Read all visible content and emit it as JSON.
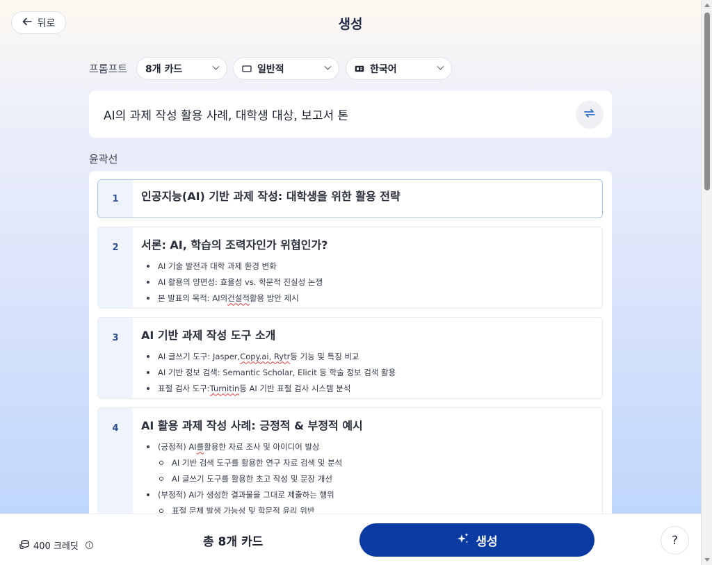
{
  "header": {
    "back_label": "뒤로",
    "title": "생성"
  },
  "prompt": {
    "label": "프롬프트",
    "card_count": "8개 카드",
    "style": "일반적",
    "language": "한국어",
    "text": "AI의 과제 작성 활용 사례, 대학생 대상, 보고서 톤"
  },
  "outline": {
    "label": "윤곽선",
    "cards": [
      {
        "num": "1",
        "title": "인공지능(AI) 기반 과제 작성: 대학생을 위한 활용 전략",
        "bullets": []
      },
      {
        "num": "2",
        "title": "서론: AI, 학습의 조력자인가 위협인가?",
        "bullets": [
          {
            "pre": "AI 기술 발전과 대학 과제 환경 변화",
            "err": "",
            "post": ""
          },
          {
            "pre": "AI 활용의 양면성: 효율성 vs. 학문적 진실성 논쟁",
            "err": "",
            "post": ""
          },
          {
            "pre": "본 발표의 목적: AI의 ",
            "err": "건설적",
            "post": " 활용 방안 제시"
          }
        ]
      },
      {
        "num": "3",
        "title": "AI 기반 과제 작성 도구 소개",
        "bullets": [
          {
            "pre": "AI 글쓰기 도구: Jasper, ",
            "err": "Copy.ai, Rytr",
            "post": " 등 기능 및 특징 비교"
          },
          {
            "pre": "AI 기반 정보 검색: Semantic Scholar, Elicit 등 학술 정보 검색 활용",
            "err": "",
            "post": ""
          },
          {
            "pre": "표절 검사 도구: ",
            "err": "Turnitin",
            "post": " 등 AI 기반 표절 검사 시스템 분석"
          }
        ]
      },
      {
        "num": "4",
        "title": "AI 활용 과제 작성 사례: 긍정적 & 부정적 예시",
        "bullets": [
          {
            "pre": "(긍정적) AI",
            "err": "를",
            "post": " 활용한 자료 조사 및 아이디어 발상"
          },
          {
            "pre": "AI 기반 검색 도구를 활용한 연구 자료 검색 및 분석",
            "err": "",
            "post": "",
            "sub": true
          },
          {
            "pre": "AI 글쓰기 도구를 활용한 초고 작성 및 문장 개선",
            "err": "",
            "post": "",
            "sub": true
          },
          {
            "pre": "(부정적) AI가 생성한 결과물을 그대로 제출하는 행위",
            "err": "",
            "post": ""
          },
          {
            "pre": "표절 문제 발생 가능성 및 학문적 윤리 위반",
            "err": "",
            "post": "",
            "sub": true
          }
        ]
      }
    ]
  },
  "footer": {
    "credits": "400 크레딧",
    "total": "총 8개 카드",
    "generate_label": "생성",
    "help": "?"
  }
}
